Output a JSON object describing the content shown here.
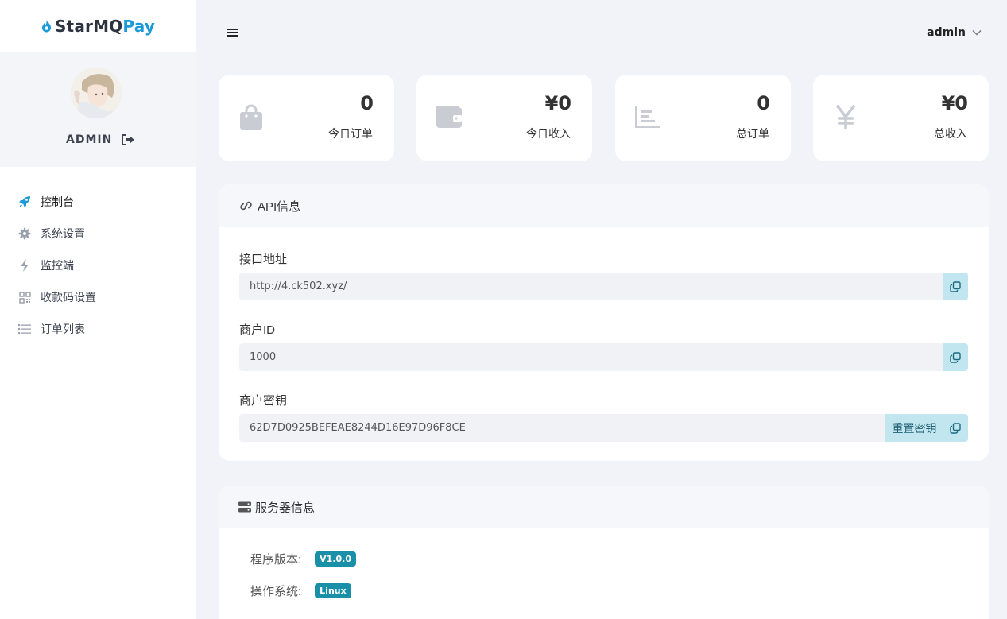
{
  "brand": {
    "part1": "StarMQ",
    "part2": "Pay",
    "accent": "#1a9ad6"
  },
  "user": {
    "name": "ADMIN",
    "menu_name": "admin"
  },
  "nav": [
    {
      "label": "控制台",
      "icon": "rocket-icon",
      "active": true
    },
    {
      "label": "系统设置",
      "icon": "gear-icon"
    },
    {
      "label": "监控端",
      "icon": "bolt-icon"
    },
    {
      "label": "收款码设置",
      "icon": "qrcode-icon"
    },
    {
      "label": "订单列表",
      "icon": "list-icon"
    }
  ],
  "stats": [
    {
      "value": "0",
      "label": "今日订单",
      "icon": "bag-icon"
    },
    {
      "value": "¥0",
      "label": "今日收入",
      "icon": "wallet-icon"
    },
    {
      "value": "0",
      "label": "总订单",
      "icon": "chart-icon"
    },
    {
      "value": "¥0",
      "label": "总收入",
      "icon": "yen-icon"
    }
  ],
  "api": {
    "title": "API信息",
    "url_label": "接口地址",
    "url": "http://4.ck502.xyz/",
    "mid_label": "商户ID",
    "mid": "1000",
    "key_label": "商户密钥",
    "key": "62D7D0925BEFEAE8244D16E97D96F8CE",
    "reset_label": "重置密钥"
  },
  "server": {
    "title": "服务器信息",
    "rows": [
      {
        "label": "程序版本:",
        "value": "V1.0.0"
      },
      {
        "label": "操作系统:",
        "value": "Linux"
      }
    ]
  }
}
